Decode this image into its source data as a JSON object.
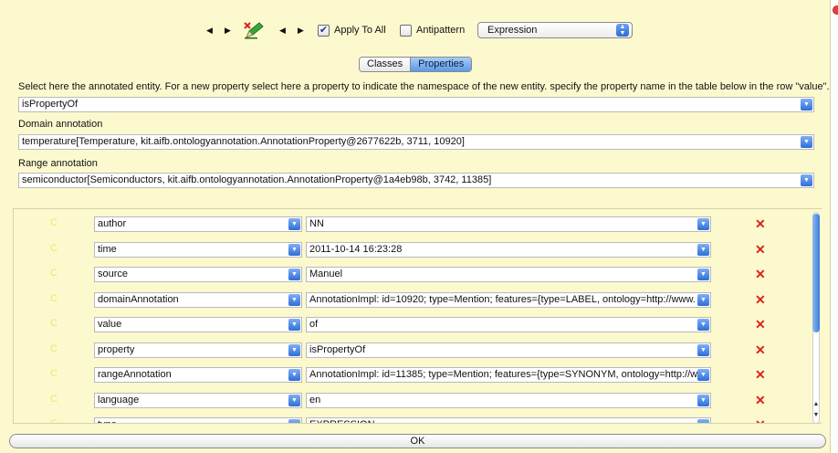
{
  "toolbar": {
    "nav_left_prev": "◀",
    "nav_left_next": "▶",
    "nav_right_prev": "◀",
    "nav_right_next": "▶",
    "apply_to_all_label": "Apply To All",
    "apply_to_all_checked": true,
    "antipattern_label": "Antipattern",
    "antipattern_checked": false,
    "type_select_value": "Expression"
  },
  "tabs": [
    {
      "label": "Classes",
      "selected": false
    },
    {
      "label": "Properties",
      "selected": true
    }
  ],
  "annotation_panel": {
    "instruction": "Select here the annotated entity. For a new property select here a property to indicate the namespace of the new entity. specify the property name in the table below in the row \"value\".",
    "entity_value": "isPropertyOf",
    "domain_label": "Domain annotation",
    "domain_value": "temperature[Temperature, kit.aifb.ontologyannotation.AnnotationProperty@2677622b, 3711, 10920]",
    "range_label": "Range annotation",
    "range_value": "semiconductor[Semiconductors, kit.aifb.ontologyannotation.AnnotationProperty@1a4eb98b, 3742, 11385]"
  },
  "properties_table": {
    "row_marker": "C",
    "delete_symbol": "✕",
    "rows": [
      {
        "key": "author",
        "value": "NN"
      },
      {
        "key": "time",
        "value": "2011-10-14 16:23:28"
      },
      {
        "key": "source",
        "value": "Manuel"
      },
      {
        "key": "domainAnnotation",
        "value": "AnnotationImpl: id=10920; type=Mention; features={type=LABEL, ontology=http://www."
      },
      {
        "key": "value",
        "value": "of"
      },
      {
        "key": "property",
        "value": "isPropertyOf"
      },
      {
        "key": "rangeAnnotation",
        "value": "AnnotationImpl: id=11385; type=Mention; features={type=SYNONYM, ontology=http://w"
      },
      {
        "key": "language",
        "value": "en"
      },
      {
        "key": "type",
        "value": "EXPRESSION"
      }
    ]
  },
  "ok_label": "OK",
  "colors": {
    "background": "#fdf9cf",
    "delete": "#d9241c",
    "row_marker": "#f1e56b",
    "accent": "#2f6ed8"
  },
  "icons": [
    "prev-arrow-icon",
    "next-arrow-icon",
    "pencil-delete-icon",
    "dropdown-icon",
    "delete-icon",
    "scroll-up-icon",
    "scroll-down-icon"
  ]
}
